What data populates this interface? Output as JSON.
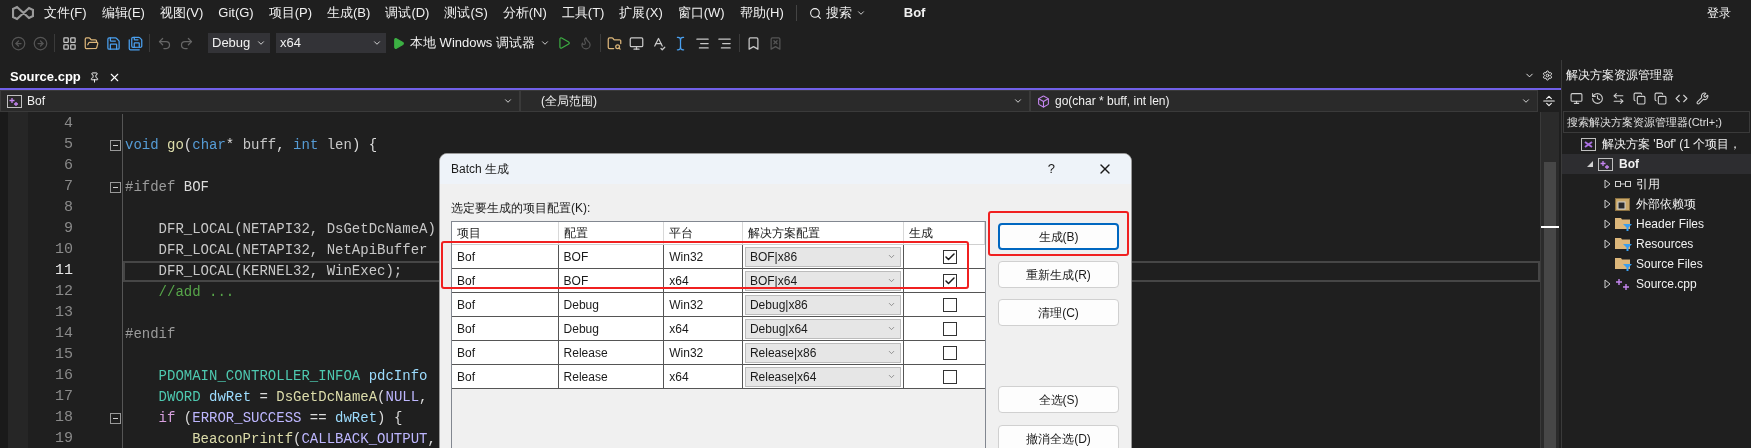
{
  "menu_bar": {
    "items": [
      "文件(F)",
      "编辑(E)",
      "视图(V)",
      "Git(G)",
      "项目(P)",
      "生成(B)",
      "调试(D)",
      "测试(S)",
      "分析(N)",
      "工具(T)",
      "扩展(X)",
      "窗口(W)",
      "帮助(H)"
    ],
    "search": "搜索",
    "solution_name": "Bof",
    "sign_in": "登录"
  },
  "toolbar": {
    "configuration": "Debug",
    "platform": "x64",
    "run_target": "本地 Windows 调试器"
  },
  "editor": {
    "tabs": [
      {
        "label": "Source.cpp",
        "selected": true
      }
    ],
    "nav": {
      "project": "Bof",
      "scope": "(全局范围)",
      "member": "go(char * buff, int len)"
    },
    "lines": [
      {
        "number": "4",
        "current": false,
        "fold": false
      },
      {
        "number": "5",
        "current": false,
        "fold": true,
        "tokens": [
          {
            "text": "void ",
            "kind": "keyword"
          },
          {
            "text": "go",
            "kind": "function"
          },
          {
            "text": "(",
            "kind": "plain"
          },
          {
            "text": "char",
            "kind": "keyword"
          },
          {
            "text": "* ",
            "kind": "plain"
          },
          {
            "text": "buff",
            "kind": "param"
          },
          {
            "text": ", ",
            "kind": "plain"
          },
          {
            "text": "int ",
            "kind": "keyword"
          },
          {
            "text": "len",
            "kind": "param"
          },
          {
            "text": ") {",
            "kind": "plain"
          }
        ]
      },
      {
        "number": "6",
        "current": false,
        "fold": false
      },
      {
        "number": "7",
        "current": false,
        "fold": true,
        "tokens": [
          {
            "text": "#ifdef ",
            "kind": "preproc"
          },
          {
            "text": "BOF",
            "kind": "plain"
          }
        ]
      },
      {
        "number": "8",
        "current": false,
        "fold": false
      },
      {
        "number": "9",
        "current": false,
        "fold": false,
        "tokens": [
          {
            "text": "    DFR_LOCAL(NETAPI32, DsGetDcNameA)",
            "kind": "dim"
          }
        ]
      },
      {
        "number": "10",
        "current": false,
        "fold": false,
        "tokens": [
          {
            "text": "    DFR_LOCAL(NETAPI32, NetApiBuffer",
            "kind": "dim"
          }
        ]
      },
      {
        "number": "11",
        "current": true,
        "fold": false,
        "tokens": [
          {
            "text": "    DFR_LOCAL(KERNEL32, WinExec);",
            "kind": "dim"
          }
        ]
      },
      {
        "number": "12",
        "current": false,
        "fold": false,
        "tokens": [
          {
            "text": "    //add ...",
            "kind": "comment"
          }
        ]
      },
      {
        "number": "13",
        "current": false,
        "fold": false
      },
      {
        "number": "14",
        "current": false,
        "fold": false,
        "tokens": [
          {
            "text": "#endif",
            "kind": "preproc"
          }
        ]
      },
      {
        "number": "15",
        "current": false,
        "fold": false
      },
      {
        "number": "16",
        "current": false,
        "fold": false,
        "tokens": [
          {
            "text": "    PDOMAIN_CONTROLLER_INFOA",
            "kind": "type"
          },
          {
            "text": " pdcInfo",
            "kind": "variable"
          }
        ]
      },
      {
        "number": "17",
        "current": false,
        "fold": false,
        "tokens": [
          {
            "text": "    DWORD",
            "kind": "type"
          },
          {
            "text": " dwRet",
            "kind": "variable"
          },
          {
            "text": " = ",
            "kind": "plain"
          },
          {
            "text": "DsGetDcNameA",
            "kind": "function"
          },
          {
            "text": "(",
            "kind": "plain"
          },
          {
            "text": "NULL",
            "kind": "macro"
          },
          {
            "text": ",",
            "kind": "plain"
          }
        ]
      },
      {
        "number": "18",
        "current": false,
        "fold": true,
        "tokens": [
          {
            "text": "    if",
            "kind": "control"
          },
          {
            "text": " (",
            "kind": "plain"
          },
          {
            "text": "ERROR_SUCCESS",
            "kind": "macro"
          },
          {
            "text": " == ",
            "kind": "plain"
          },
          {
            "text": "dwRet",
            "kind": "variable"
          },
          {
            "text": ") {",
            "kind": "plain"
          }
        ]
      },
      {
        "number": "19",
        "current": false,
        "fold": false,
        "tokens": [
          {
            "text": "        BeaconPrintf",
            "kind": "function"
          },
          {
            "text": "(",
            "kind": "plain"
          },
          {
            "text": "CALLBACK_OUTPUT",
            "kind": "macro"
          },
          {
            "text": ",",
            "kind": "plain"
          }
        ]
      }
    ]
  },
  "solution_explorer": {
    "title": "解决方案资源管理器",
    "search": {
      "placeholder": "搜索解决方案资源管理器(Ctrl+;)"
    },
    "tree": [
      {
        "label": "解决方案 'Bof' (1 个项目，",
        "kind": "solution",
        "expandable": false,
        "selected": false,
        "children": [
          {
            "label": "Bof",
            "kind": "project",
            "expandable": true,
            "expanded": true,
            "selected": true,
            "children": [
              {
                "label": "引用",
                "kind": "references",
                "expandable": true,
                "expanded": false,
                "selected": false
              },
              {
                "label": "外部依赖项",
                "kind": "external",
                "expandable": true,
                "expanded": false,
                "selected": false
              },
              {
                "label": "Header Files",
                "kind": "filter",
                "expandable": true,
                "expanded": false,
                "selected": false
              },
              {
                "label": "Resources",
                "kind": "filter",
                "expandable": true,
                "expanded": false,
                "selected": false
              },
              {
                "label": "Source Files",
                "kind": "filter",
                "expandable": false,
                "selected": false
              },
              {
                "label": "Source.cpp",
                "kind": "cpp",
                "expandable": true,
                "expanded": false,
                "selected": false
              }
            ]
          }
        ]
      }
    ]
  },
  "dialog": {
    "title": "Batch 生成",
    "help": "?",
    "label": "选定要生成的项目配置(K):",
    "columns": [
      "项目",
      "配置",
      "平台",
      "解决方案配置",
      "生成"
    ],
    "rows": [
      {
        "project": "Bof",
        "configuration": "BOF",
        "platform": "Win32",
        "solution_configuration": "BOF|x86",
        "build": true
      },
      {
        "project": "Bof",
        "configuration": "BOF",
        "platform": "x64",
        "solution_configuration": "BOF|x64",
        "build": true
      },
      {
        "project": "Bof",
        "configuration": "Debug",
        "platform": "Win32",
        "solution_configuration": "Debug|x86",
        "build": false
      },
      {
        "project": "Bof",
        "configuration": "Debug",
        "platform": "x64",
        "solution_configuration": "Debug|x64",
        "build": false
      },
      {
        "project": "Bof",
        "configuration": "Release",
        "platform": "Win32",
        "solution_configuration": "Release|x86",
        "build": false
      },
      {
        "project": "Bof",
        "configuration": "Release",
        "platform": "x64",
        "solution_configuration": "Release|x64",
        "build": false
      }
    ],
    "buttons_top": [
      {
        "label": "生成(B)",
        "default": true
      },
      {
        "label": "重新生成(R)",
        "default": false
      },
      {
        "label": "清理(C)",
        "default": false
      }
    ],
    "buttons_bottom": [
      {
        "label": "全选(S)",
        "default": false
      },
      {
        "label": "撤消全选(D)",
        "default": false
      }
    ]
  }
}
